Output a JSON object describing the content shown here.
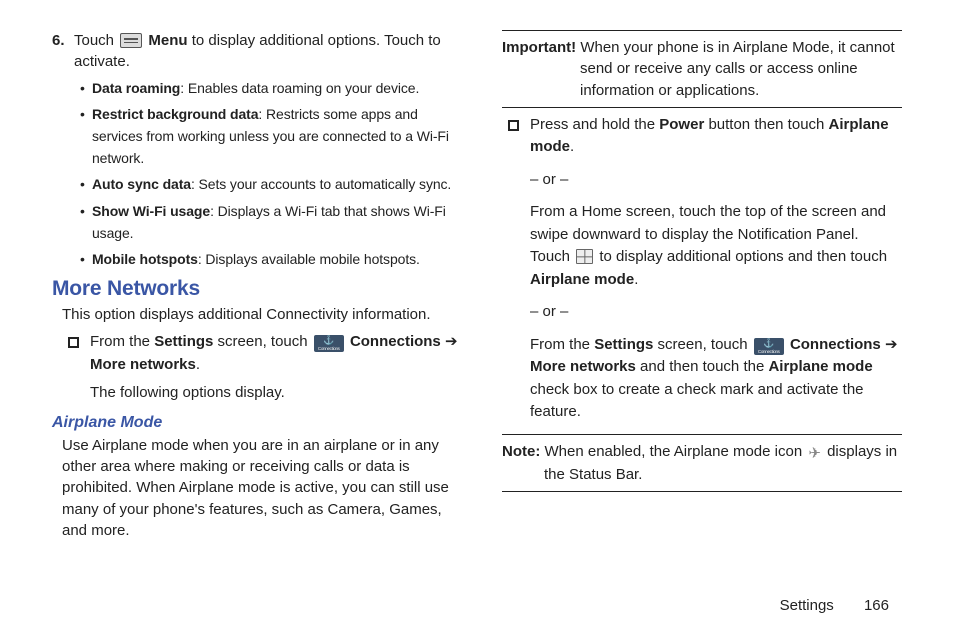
{
  "left": {
    "step6": {
      "num": "6.",
      "pre": "Touch ",
      "menu_bold": "Menu",
      "post": " to display additional options. Touch to activate."
    },
    "bullets": [
      {
        "bold": "Data roaming",
        "rest": ": Enables data roaming on your device."
      },
      {
        "bold": "Restrict background data",
        "rest": ": Restricts some apps and services from working unless you are connected to a Wi-Fi network."
      },
      {
        "bold": "Auto sync data",
        "rest": ": Sets your accounts to automatically sync."
      },
      {
        "bold": "Show Wi-Fi usage",
        "rest": ": Displays a Wi-Fi tab that shows Wi-Fi usage."
      },
      {
        "bold": "Mobile hotspots",
        "rest": ": Displays available mobile hotspots."
      }
    ],
    "h2": "More Networks",
    "lead": "This option displays additional Connectivity information.",
    "sq": {
      "pre": "From the ",
      "settings": "Settings",
      "mid": " screen, touch  ",
      "conn": "Connections",
      "arrow": " ➔ ",
      "more": "More networks",
      "end": ".",
      "result": "The following options display."
    },
    "h3": "Airplane Mode",
    "airplane_para": "Use Airplane mode when you are in an airplane or in any other area where making or receiving calls or data is prohibited. When Airplane mode is active, you can still use many of your phone's features, such as Camera, Games, and more."
  },
  "right": {
    "important": {
      "label": "Important! ",
      "text_line1": "When your phone is in Airplane Mode, it cannot",
      "text_rest": "send or receive any calls or access online information or applications."
    },
    "sq": {
      "l1a": "Press and hold the ",
      "power": "Power",
      "l1b": " button then touch ",
      "am1": "Airplane mode",
      "l1c": ".",
      "or": "– or –",
      "l2a": "From a Home screen, touch the top of the screen and swipe downward to display the Notification Panel. Touch ",
      "l2b": " to display additional options and then touch ",
      "am2": "Airplane mode",
      "l2c": ".",
      "l3a": "From the ",
      "settings": "Settings",
      "l3b": " screen, touch  ",
      "conn": "Connections",
      "arrow2": " ➔ ",
      "more": "More networks",
      "l3c": " and then touch the ",
      "am3": "Airplane mode",
      "l3d": " check box to create a check mark and activate the feature."
    },
    "note": {
      "label": "Note: ",
      "pre": "When enabled, the Airplane mode icon ",
      "post": " displays in",
      "line2": "the Status Bar."
    }
  },
  "footer": {
    "section": "Settings",
    "page": "166"
  }
}
